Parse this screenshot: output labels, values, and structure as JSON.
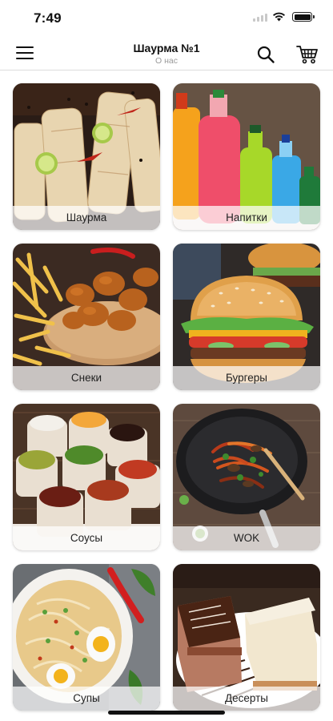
{
  "status_bar": {
    "time": "7:49"
  },
  "header": {
    "title": "Шаурма №1",
    "subtitle": "О нас",
    "icons": {
      "menu": "hamburger-menu-icon",
      "search": "search-icon",
      "cart": "shopping-cart-icon"
    }
  },
  "categories": [
    {
      "label": "Шаурма"
    },
    {
      "label": "Напитки"
    },
    {
      "label": "Снеки"
    },
    {
      "label": "Бургеры"
    },
    {
      "label": "Соусы"
    },
    {
      "label": "WOK"
    },
    {
      "label": "Супы"
    },
    {
      "label": "Десерты"
    }
  ]
}
